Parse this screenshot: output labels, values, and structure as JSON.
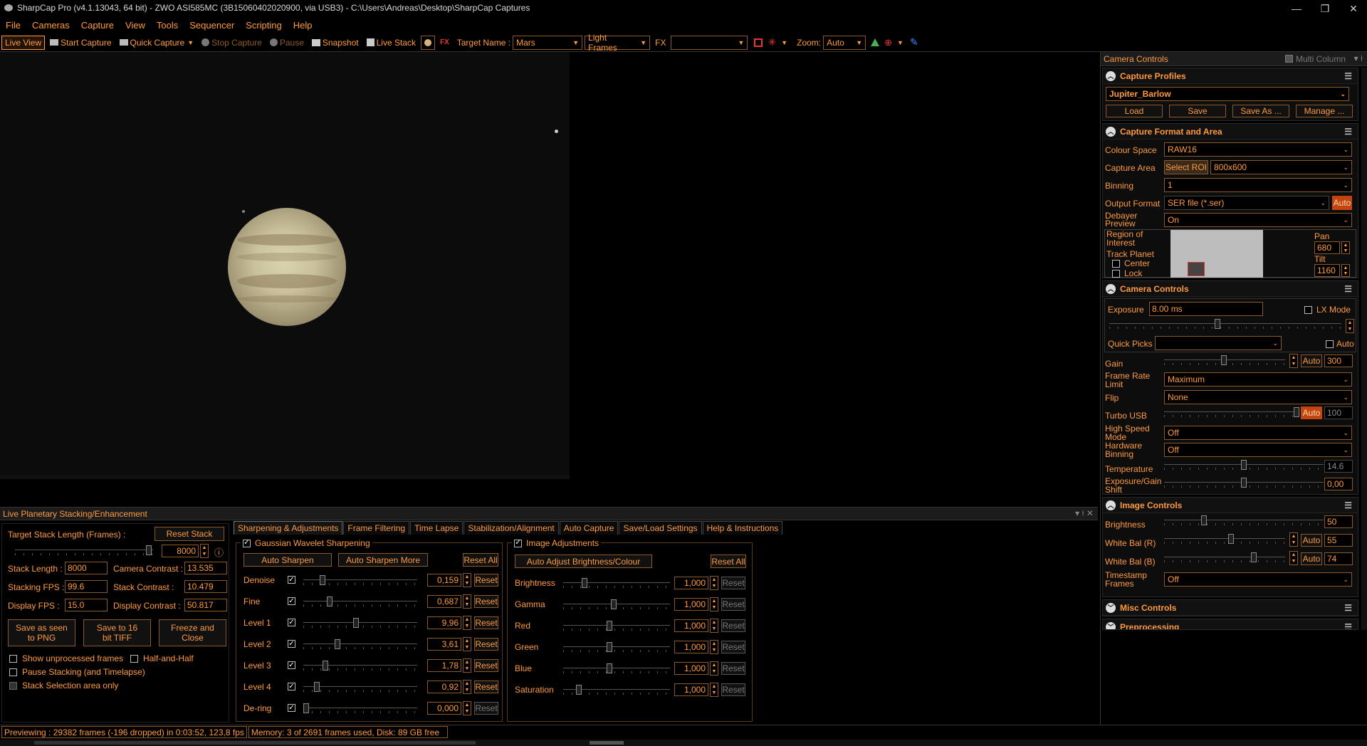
{
  "window": {
    "title": "SharpCap Pro (v4.1.13043, 64 bit) - ZWO ASI585MC (3B15060402020900, via USB3) - C:\\Users\\Andreas\\Desktop\\SharpCap Captures",
    "minimize": "—",
    "restore": "❐",
    "close": "✕"
  },
  "menu": [
    "File",
    "Cameras",
    "Capture",
    "View",
    "Tools",
    "Sequencer",
    "Scripting",
    "Help"
  ],
  "toolbar": {
    "live_view": "Live View",
    "start_capture": "Start Capture",
    "quick_capture": "Quick Capture",
    "stop_capture": "Stop Capture",
    "pause": "Pause",
    "snapshot": "Snapshot",
    "live_stack": "Live Stack",
    "target_name_label": "Target Name :",
    "target_name_value": "Mars",
    "frame_type": "Light Frames",
    "fx_label": "FX",
    "fx_value": "",
    "zoom_label": "Zoom:",
    "zoom_value": "Auto"
  },
  "camera_controls": {
    "panel_title": "Camera Controls",
    "multi_column": "Multi Column",
    "capture_profiles": {
      "title": "Capture Profiles",
      "profile": "Jupiter_Barlow",
      "load": "Load",
      "save": "Save",
      "save_as": "Save As ...",
      "manage": "Manage ..."
    },
    "format_area": {
      "title": "Capture Format and Area",
      "colour_space_label": "Colour Space",
      "colour_space_value": "RAW16",
      "capture_area_label": "Capture Area",
      "select_roi": "Select ROI",
      "capture_area_value": "800x600",
      "binning_label": "Binning",
      "binning_value": "1",
      "output_format_label": "Output Format",
      "output_format_value": "SER file (*.ser)",
      "auto": "Auto",
      "debayer_label": "Debayer Preview",
      "debayer_value": "On",
      "roi_label": "Region of Interest",
      "track_planet": "Track Planet",
      "center": "Center",
      "lock": "Lock",
      "pan_label": "Pan",
      "pan_value": "680",
      "tilt_label": "Tilt",
      "tilt_value": "1160"
    },
    "camera": {
      "title": "Camera Controls",
      "exposure_label": "Exposure",
      "exposure_value": "8.00 ms",
      "lx_mode": "LX Mode",
      "quick_picks_label": "Quick Picks",
      "quick_picks_auto": "Auto",
      "gain_label": "Gain",
      "gain_auto": "Auto",
      "gain_value": "300",
      "frame_rate_label": "Frame Rate Limit",
      "frame_rate_value": "Maximum",
      "flip_label": "Flip",
      "flip_value": "None",
      "turbo_label": "Turbo USB",
      "turbo_auto": "Auto",
      "turbo_value": "100",
      "high_speed_label": "High Speed Mode",
      "high_speed_value": "Off",
      "hw_binning_label": "Hardware Binning",
      "hw_binning_value": "Off",
      "temperature_label": "Temperature",
      "temperature_value": "14.6",
      "exp_gain_shift_label": "Exposure/Gain Shift",
      "exp_gain_shift_value": "0,00"
    },
    "image": {
      "title": "Image Controls",
      "brightness_label": "Brightness",
      "brightness_value": "50",
      "wb_r_label": "White Bal (R)",
      "wb_r_auto": "Auto",
      "wb_r_value": "55",
      "wb_b_label": "White Bal (B)",
      "wb_b_auto": "Auto",
      "wb_b_value": "74",
      "timestamp_label": "Timestamp Frames",
      "timestamp_value": "Off"
    },
    "misc_title": "Misc Controls",
    "preprocessing_title": "Preprocessing"
  },
  "stacking": {
    "panel_title": "Live Planetary Stacking/Enhancement",
    "target_stack_label": "Target Stack Length (Frames) :",
    "reset_stack": "Reset Stack",
    "target_stack_value": "8000",
    "stack_length_label": "Stack Length :",
    "stack_length_value": "8000",
    "camera_contrast_label": "Camera Contrast :",
    "camera_contrast_value": "13.535",
    "stacking_fps_label": "Stacking FPS :",
    "stacking_fps_value": "99.6",
    "stack_contrast_label": "Stack Contrast :",
    "stack_contrast_value": "10.479",
    "display_fps_label": "Display FPS :",
    "display_fps_value": "15.0",
    "display_contrast_label": "Display Contrast :",
    "display_contrast_value": "50.817",
    "save_png": "Save as seen to PNG",
    "save_tiff": "Save to 16 bit TIFF",
    "freeze_close": "Freeze and Close",
    "show_unprocessed": "Show unprocessed frames",
    "half_and_half": "Half-and-Half",
    "pause_stacking": "Pause Stacking (and Timelapse)",
    "stack_selection": "Stack Selection area only",
    "tabs": [
      "Sharpening & Adjustments",
      "Frame Filtering",
      "Time Lapse",
      "Stabilization/Alignment",
      "Auto Capture",
      "Save/Load Settings",
      "Help & Instructions"
    ],
    "wavelet": {
      "title": "Gaussian Wavelet Sharpening",
      "auto_sharpen": "Auto Sharpen",
      "auto_sharpen_more": "Auto Sharpen More",
      "reset_all": "Reset All",
      "reset": "Reset",
      "rows": [
        {
          "label": "Denoise",
          "value": "0,159",
          "level": 0.15
        },
        {
          "label": "Fine",
          "value": "0,687",
          "level": 0.22
        },
        {
          "label": "Level 1",
          "value": "9,96",
          "level": 0.46
        },
        {
          "label": "Level 2",
          "value": "3,61",
          "level": 0.29
        },
        {
          "label": "Level 3",
          "value": "1,78",
          "level": 0.18
        },
        {
          "label": "Level 4",
          "value": "0,92",
          "level": 0.1
        },
        {
          "label": "De-ring",
          "value": "0,000",
          "level": 0.0
        }
      ]
    },
    "image_adj": {
      "title": "Image Adjustments",
      "auto_adjust": "Auto Adjust Brightness/Colour",
      "reset_all": "Reset All",
      "reset": "Reset",
      "rows": [
        {
          "label": "Brightness",
          "value": "1,000",
          "level": 0.18
        },
        {
          "label": "Gamma",
          "value": "1,000",
          "level": 0.47
        },
        {
          "label": "Red",
          "value": "1,000",
          "level": 0.43
        },
        {
          "label": "Green",
          "value": "1,000",
          "level": 0.43
        },
        {
          "label": "Blue",
          "value": "1,000",
          "level": 0.43
        },
        {
          "label": "Saturation",
          "value": "1,000",
          "level": 0.13
        }
      ]
    }
  },
  "status": {
    "preview": "Previewing : 29382 frames (-196 dropped) in 0:03:52, 123,8 fps",
    "memory": "Memory: 3 of 2691 frames used, Disk: 89 GB free"
  }
}
